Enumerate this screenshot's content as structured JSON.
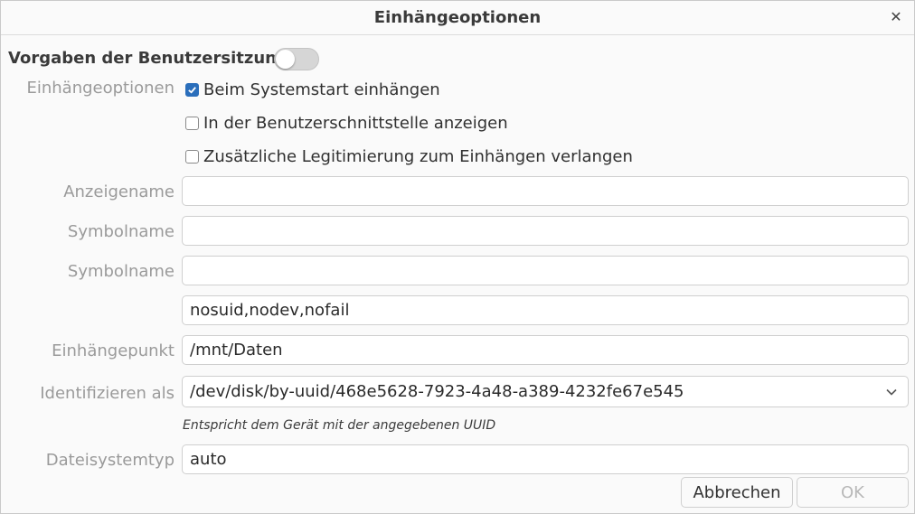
{
  "window": {
    "title": "Einhängeoptionen"
  },
  "session": {
    "label": "Vorgaben der Benutzersitzung",
    "toggle_on": false
  },
  "mount_options": {
    "label": "Einhängeoptionen",
    "checkboxes": [
      {
        "label": "Beim Systemstart einhängen",
        "checked": true
      },
      {
        "label": "In der Benutzerschnittstelle anzeigen",
        "checked": false
      },
      {
        "label": "Zusätzliche Legitimierung zum Einhängen verlangen",
        "checked": false
      }
    ]
  },
  "fields": {
    "display_name": {
      "label": "Anzeigename",
      "value": ""
    },
    "icon_name": {
      "label": "Symbolname",
      "value": ""
    },
    "symbolic_icon_name": {
      "label": "Symbolname",
      "value": ""
    },
    "options": {
      "value": "nosuid,nodev,nofail"
    },
    "mount_point": {
      "label": "Einhängepunkt",
      "value": "/mnt/Daten"
    },
    "identify_as": {
      "label": "Identifizieren als",
      "value": "/dev/disk/by-uuid/468e5628-7923-4a48-a389-4232fe67e545",
      "hint": "Entspricht dem Gerät mit der angegebenen UUID"
    },
    "fs_type": {
      "label": "Dateisystemtyp",
      "value": "auto"
    }
  },
  "buttons": {
    "cancel": "Abbrechen",
    "ok": "OK"
  },
  "colors": {
    "accent": "#2a6ebb",
    "dim_label": "#9a9a9a"
  }
}
